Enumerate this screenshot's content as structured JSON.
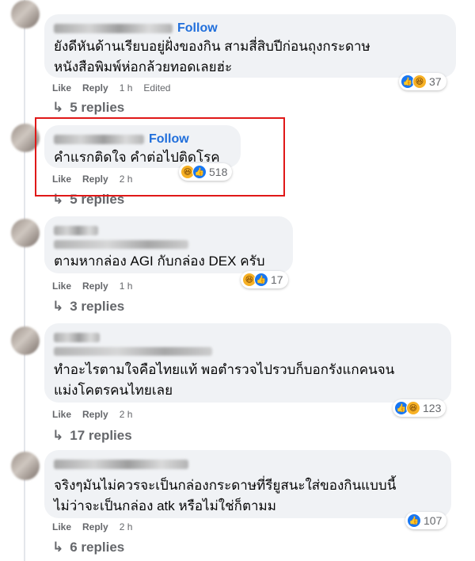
{
  "accent_color": "#216fdb",
  "highlight_color": "#e01818",
  "comments": [
    {
      "follow_label": "Follow",
      "text": "ยังดีหันด้านเรียบอยู่ฝั่งของกิน สามสี่สิบปีก่อนถุงกระดาษ\nหนังสือพิมพ์ห่อกล้วยทอดเลยฮ่ะ",
      "like_label": "Like",
      "reply_label": "Reply",
      "time": "1 h",
      "edited": "Edited",
      "reaction_icons": [
        "like-icon",
        "haha-icon"
      ],
      "reaction_count": "37",
      "replies_label": "5 replies"
    },
    {
      "follow_label": "Follow",
      "text": "คำแรกติดใจ คำต่อไปติดโรค",
      "like_label": "Like",
      "reply_label": "Reply",
      "time": "2 h",
      "reaction_icons": [
        "haha-icon",
        "like-icon"
      ],
      "reaction_count": "518",
      "replies_label": "5 replies"
    },
    {
      "text": "ตามหากล่อง AGI กับกล่อง DEX ครับ",
      "like_label": "Like",
      "reply_label": "Reply",
      "time": "1 h",
      "reaction_icons": [
        "haha-icon",
        "like-icon"
      ],
      "reaction_count": "17",
      "replies_label": "3 replies"
    },
    {
      "text": "ทำอะไรตามใจคือไทยแท้ พอตำรวจไปรวบก็บอกรังแกคนจน\nแม่งโคตรคนไทยเลย",
      "like_label": "Like",
      "reply_label": "Reply",
      "time": "2 h",
      "reaction_icons": [
        "like-icon",
        "haha-icon"
      ],
      "reaction_count": "123",
      "replies_label": "17 replies"
    },
    {
      "text": "จริงๆมันไม่ควรจะเป็นกล่องกระดาษที่รียูสนะใส่ของกินแบบนี้\nไม่ว่าจะเป็นกล่อง atk หรือไม่ใช่ก็ตามม",
      "like_label": "Like",
      "reply_label": "Reply",
      "time": "2 h",
      "reaction_icons": [
        "like-icon"
      ],
      "reaction_count": "107",
      "replies_label": "6 replies"
    }
  ]
}
